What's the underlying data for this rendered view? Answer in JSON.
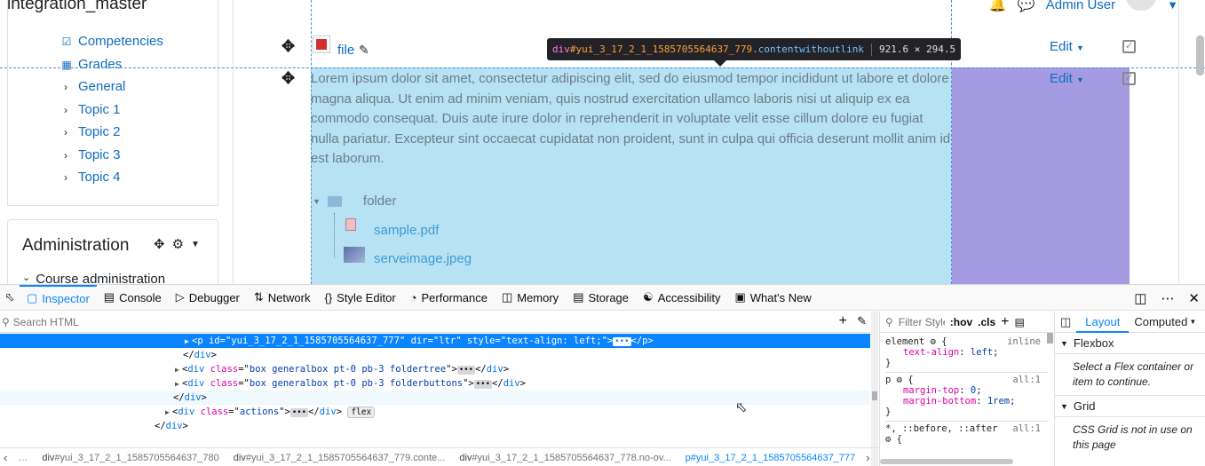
{
  "page": {
    "site_title": "integration_master",
    "user_name": "Admin User",
    "nav_items": [
      {
        "label": "Competencies",
        "icon": "check-square-icon"
      },
      {
        "label": "Grades",
        "icon": "table-icon"
      },
      {
        "label": "General",
        "icon": "chevron-right-icon"
      },
      {
        "label": "Topic 1",
        "icon": "chevron-right-icon"
      },
      {
        "label": "Topic 2",
        "icon": "chevron-right-icon"
      },
      {
        "label": "Topic 3",
        "icon": "chevron-right-icon"
      },
      {
        "label": "Topic 4",
        "icon": "chevron-right-icon"
      }
    ],
    "admin_title": "Administration",
    "course_admin": "Course administration",
    "file_label": "file",
    "edit_label": "Edit",
    "lorem": "Lorem ipsum dolor sit amet, consectetur adipiscing elit, sed do eiusmod tempor incididunt ut labore et dolore magna aliqua. Ut enim ad minim veniam, quis nostrud exercitation ullamco laboris nisi ut aliquip ex ea commodo consequat. Duis aute irure dolor in reprehenderit in voluptate velit esse cillum dolore eu fugiat nulla pariatur. Excepteur sint occaecat cupidatat non proident, sunt in culpa qui officia deserunt mollit anim id est laborum.",
    "folder_label": "folder",
    "files": [
      "sample.pdf",
      "serveimage.jpeg"
    ],
    "tooltip": {
      "tag": "div",
      "id": "#yui_3_17_2_1_1585705564637_779",
      "cls": ".contentwithoutlink",
      "dims": "921.6 × 294.5"
    }
  },
  "devtools": {
    "tabs": [
      {
        "label": "Inspector",
        "icon": "inspector-icon",
        "active": true
      },
      {
        "label": "Console",
        "icon": "console-icon"
      },
      {
        "label": "Debugger",
        "icon": "debugger-icon"
      },
      {
        "label": "Network",
        "icon": "network-icon"
      },
      {
        "label": "Style Editor",
        "icon": "style-editor-icon"
      },
      {
        "label": "Performance",
        "icon": "performance-icon"
      },
      {
        "label": "Memory",
        "icon": "memory-icon"
      },
      {
        "label": "Storage",
        "icon": "storage-icon"
      },
      {
        "label": "Accessibility",
        "icon": "accessibility-icon"
      },
      {
        "label": "What's New",
        "icon": "gift-icon"
      }
    ],
    "search_placeholder": "Search HTML",
    "html_lines": {
      "l1_tag": "p",
      "l1_id": "yui_3_17_2_1_1585705564637_777",
      "l1_dir": "ltr",
      "l1_style": "text-align: left;",
      "l2": "div",
      "l3_cls": "box generalbox pt-0 pb-3 foldertree",
      "l4_cls": "box generalbox pt-0 pb-3 folderbuttons",
      "l5": "div",
      "l6_cls": "actions",
      "l6_badge": "flex",
      "l7": "div"
    },
    "breadcrumbs": [
      {
        "text": "…"
      },
      {
        "tag": "div",
        "rest": "#yui_3_17_2_1_1585705564637_780"
      },
      {
        "tag": "div",
        "rest": "#yui_3_17_2_1_1585705564637_779.conte..."
      },
      {
        "tag": "div",
        "rest": "#yui_3_17_2_1_1585705564637_778.no-ov..."
      },
      {
        "tag": "p",
        "rest": "#yui_3_17_2_1_1585705564637_777"
      }
    ],
    "rules": {
      "filter_placeholder": "Filter Styles",
      "hov": ":hov",
      "cls": ".cls",
      "r1_selector": "element",
      "r1_src": "inline",
      "r1_p": "text-align",
      "r1_v": "left",
      "r2_selector": "p",
      "r2_src": "all:1",
      "r2_p1": "margin-top",
      "r2_v1": "0",
      "r2_p2": "margin-bottom",
      "r2_v2": "1rem",
      "r3_selector": "*, ::before, ::after",
      "r3_src": "all:1"
    },
    "layout": {
      "tab_layout": "Layout",
      "tab_computed": "Computed",
      "flexbox_title": "Flexbox",
      "flexbox_note": "Select a Flex container or item to continue.",
      "grid_title": "Grid",
      "grid_note": "CSS Grid is not in use on this page"
    }
  }
}
